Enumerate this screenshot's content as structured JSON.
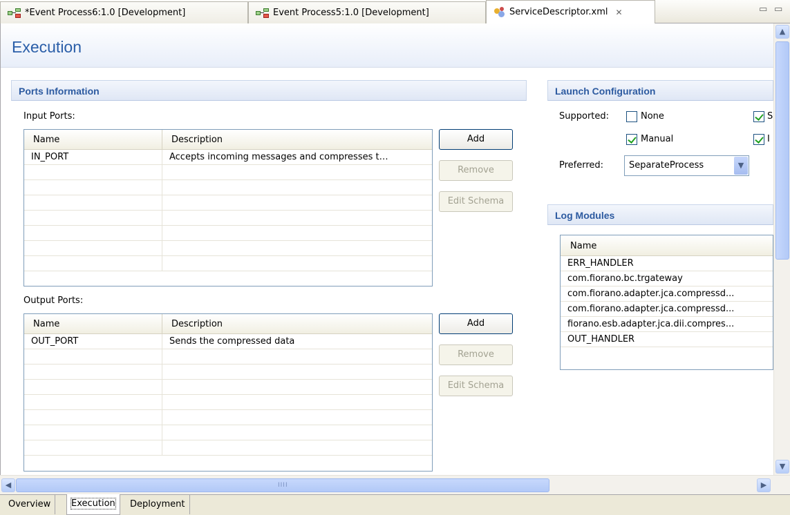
{
  "tabs": [
    {
      "label": "*Event Process6:1.0 [Development]"
    },
    {
      "label": "Event Process5:1.0 [Development]"
    },
    {
      "label": "ServiceDescriptor.xml"
    }
  ],
  "window_controls": {
    "minimize": "▭",
    "maximize": "▭"
  },
  "page_title": "Execution",
  "ports": {
    "section_title": "Ports Information",
    "input_label": "Input Ports:",
    "output_label": "Output Ports:",
    "columns": [
      "Name",
      "Description"
    ],
    "input_rows": [
      {
        "name": "IN_PORT",
        "description": "Accepts incoming messages and compresses t…"
      }
    ],
    "output_rows": [
      {
        "name": "OUT_PORT",
        "description": "Sends the compressed data"
      }
    ],
    "buttons": {
      "add": "Add",
      "remove": "Remove",
      "edit_schema": "Edit Schema"
    }
  },
  "launch": {
    "section_title": "Launch Configuration",
    "supported_label": "Supported:",
    "options": [
      {
        "label": "None",
        "checked": false
      },
      {
        "label": "Manual",
        "checked": true
      }
    ],
    "partial_options": [
      "S",
      "I"
    ],
    "preferred_label": "Preferred:",
    "preferred_value": "SeparateProcess"
  },
  "logs": {
    "section_title": "Log Modules",
    "column": "Name",
    "rows": [
      "ERR_HANDLER",
      "com.fiorano.bc.trgateway",
      "com.fiorano.adapter.jca.compressd...",
      "com.fiorano.adapter.jca.compressd...",
      "fiorano.esb.adapter.jca.dii.compres...",
      "OUT_HANDLER"
    ]
  },
  "scrollbar": {
    "up": "▲",
    "down": "▼",
    "left": "◀",
    "right": "▶",
    "grip": "IIII"
  },
  "page_tabs": [
    {
      "label": "Overview"
    },
    {
      "label": "Execution",
      "active": true
    },
    {
      "label": "Deployment"
    }
  ],
  "colors": {
    "accent_title": "#2a5ea8",
    "section_title": "#2c5aa0",
    "check": "#21a121"
  }
}
